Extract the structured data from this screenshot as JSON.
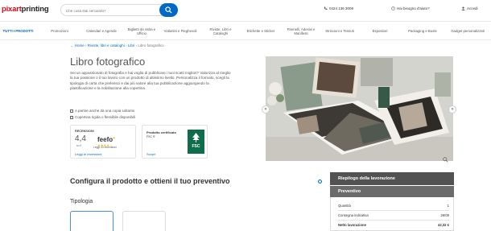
{
  "header": {
    "logo_part1": "pixart",
    "logo_part2": "printing",
    "search_placeholder": "Che cosa stai cercando?",
    "phone": "0424 136 3009",
    "help": "Hai bisogno d'aiuto?",
    "login": "Accedi"
  },
  "nav": {
    "items": [
      "TUTTI I PRODOTTI",
      "Promozioni",
      "Calendari e Agende",
      "Biglietti da visita e Ufficio",
      "Volantini e Pieghevoli",
      "Riviste, Libri e Cataloghi",
      "Etichette e Sticker",
      "Pannelli, Adesivi e Manifesti",
      "Striscioni e Tessuti",
      "Espositori",
      "Packaging e Buste",
      "Gadget personalizzati"
    ]
  },
  "breadcrumb": {
    "home": "Home",
    "cat": "Riviste, libri e cataloghi",
    "sub": "Libri",
    "current": "Libro fotografico"
  },
  "product": {
    "title": "Libro fotografico",
    "description": "Sei un appassionato di fotografia e hai voglia di pubblicare i tuoi scatti migliori? Valorizza al meglio la tua passione o il tuo lavoro con un prodotto di altissimo livello. Personalizza il formato, scegli la tipologia di carta che preferisci e dai più valore alla tua pubblicazione aggiungendo la plastificazione e la nobilitazione alla copertina.",
    "check1": "A partire anche da una copia soltanto",
    "check2": "Copertina rigida o flessibile disponibili"
  },
  "reviews": {
    "label": "RECENSIONI",
    "score": "4,4",
    "out_of": "su 5",
    "brand": "feefo",
    "count": "Leggi 43 recensioni",
    "read_link": "Leggi le recensioni",
    "rating": 4.4
  },
  "fsc": {
    "line1": "Prodotto certificato",
    "line2": "FSC ®",
    "link": "Scopri",
    "badge": "FSC"
  },
  "configure": {
    "title": "Configura il prodotto e ottieni il tuo preventivo",
    "info": "i",
    "tipologia": "Tipologia"
  },
  "summary": {
    "header": "Riepilogo della lavorazione",
    "subheader": "Preventivo",
    "rows": [
      {
        "label": "Quantità",
        "value": "1"
      },
      {
        "label": "Consegna indicativa",
        "value": "26/09"
      },
      {
        "label": "Netto lavorazione",
        "value": "42,32 €"
      }
    ]
  },
  "colors": {
    "brand_red": "#e30613",
    "link_blue": "#0069c8",
    "summary_dark": "#525252"
  }
}
